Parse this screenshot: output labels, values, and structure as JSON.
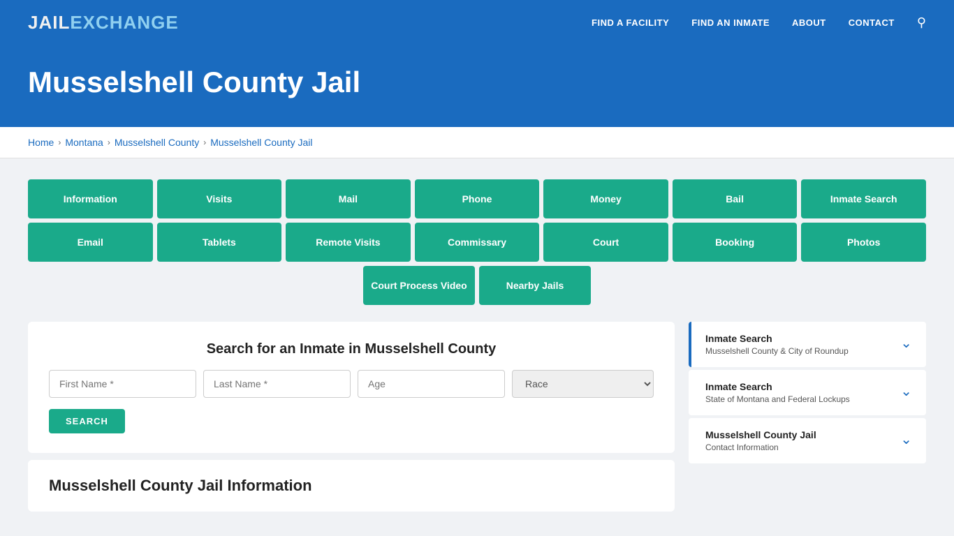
{
  "header": {
    "logo_jail": "JAIL",
    "logo_exchange": "EXCHANGE",
    "nav": [
      {
        "id": "find-facility",
        "label": "FIND A FACILITY"
      },
      {
        "id": "find-inmate",
        "label": "FIND AN INMATE"
      },
      {
        "id": "about",
        "label": "ABOUT"
      },
      {
        "id": "contact",
        "label": "CONTACT"
      }
    ]
  },
  "hero": {
    "title": "Musselshell County Jail"
  },
  "breadcrumb": {
    "items": [
      {
        "id": "home",
        "label": "Home"
      },
      {
        "id": "montana",
        "label": "Montana"
      },
      {
        "id": "musselshell-county",
        "label": "Musselshell County"
      },
      {
        "id": "musselshell-county-jail",
        "label": "Musselshell County Jail"
      }
    ]
  },
  "categories_row1": [
    {
      "id": "information",
      "label": "Information"
    },
    {
      "id": "visits",
      "label": "Visits"
    },
    {
      "id": "mail",
      "label": "Mail"
    },
    {
      "id": "phone",
      "label": "Phone"
    },
    {
      "id": "money",
      "label": "Money"
    },
    {
      "id": "bail",
      "label": "Bail"
    },
    {
      "id": "inmate-search",
      "label": "Inmate Search"
    }
  ],
  "categories_row2": [
    {
      "id": "email",
      "label": "Email"
    },
    {
      "id": "tablets",
      "label": "Tablets"
    },
    {
      "id": "remote-visits",
      "label": "Remote Visits"
    },
    {
      "id": "commissary",
      "label": "Commissary"
    },
    {
      "id": "court",
      "label": "Court"
    },
    {
      "id": "booking",
      "label": "Booking"
    },
    {
      "id": "photos",
      "label": "Photos"
    }
  ],
  "categories_row3": [
    {
      "id": "court-process-video",
      "label": "Court Process Video"
    },
    {
      "id": "nearby-jails",
      "label": "Nearby Jails"
    }
  ],
  "search": {
    "title": "Search for an Inmate in Musselshell County",
    "first_name_placeholder": "First Name *",
    "last_name_placeholder": "Last Name *",
    "age_placeholder": "Age",
    "race_placeholder": "Race",
    "button_label": "SEARCH"
  },
  "sidebar": {
    "cards": [
      {
        "id": "inmate-search-roundup",
        "title": "Inmate Search",
        "subtitle": "Musselshell County & City of Roundup",
        "active": true
      },
      {
        "id": "inmate-search-montana",
        "title": "Inmate Search",
        "subtitle": "State of Montana and Federal Lockups",
        "active": false
      },
      {
        "id": "contact-info",
        "title": "Musselshell County Jail",
        "subtitle": "Contact Information",
        "active": false
      }
    ]
  },
  "jail_info": {
    "title": "Musselshell County Jail Information"
  }
}
